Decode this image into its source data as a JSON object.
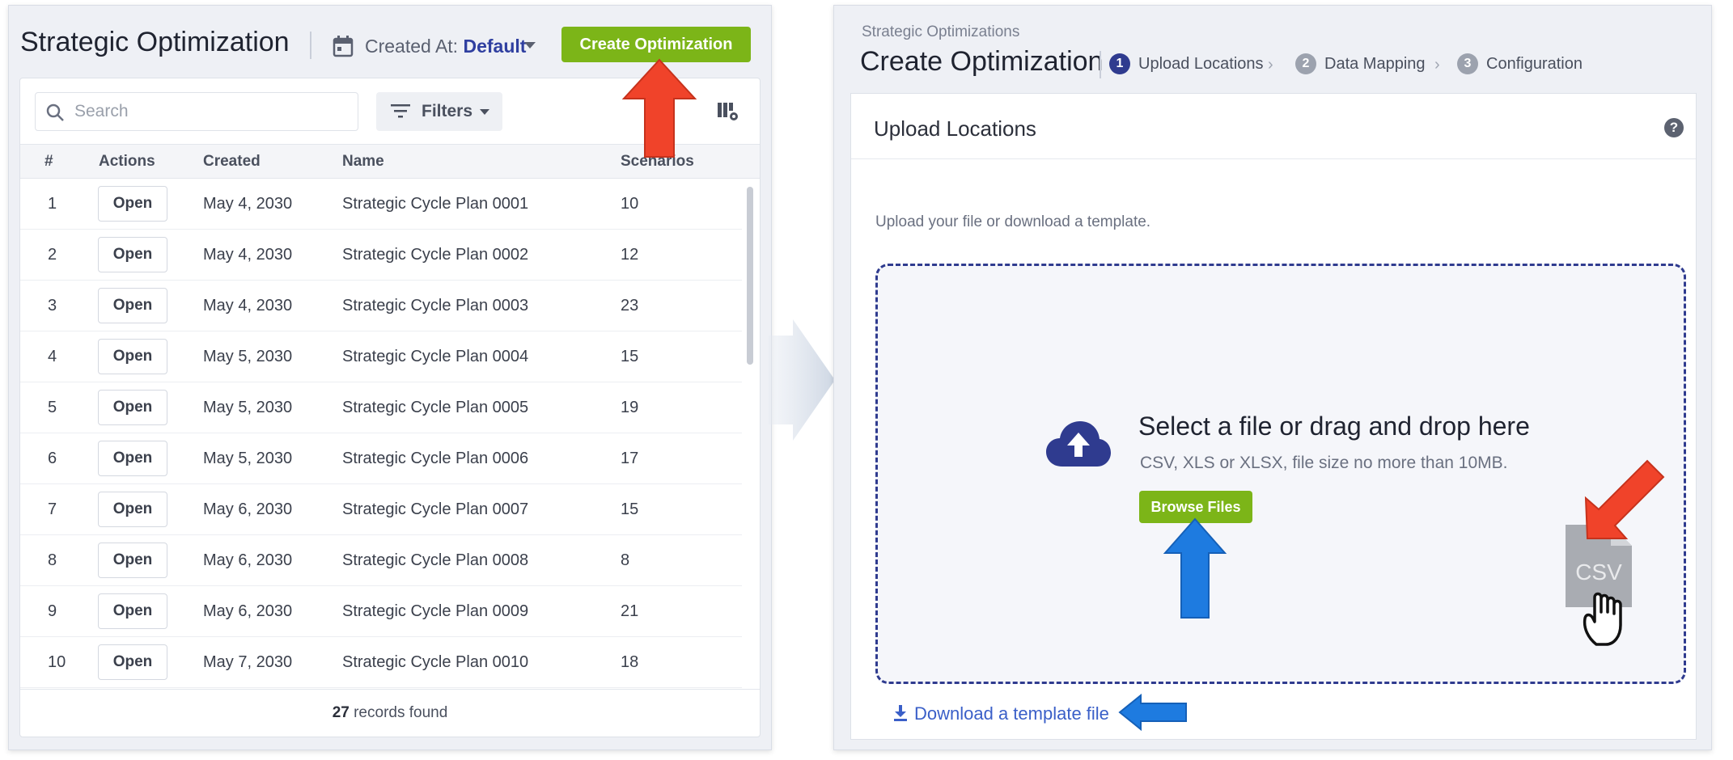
{
  "left": {
    "title": "Strategic Optimization",
    "created_at_label": "Created At:",
    "created_at_value": "Default",
    "create_button": "Create Optimization",
    "search_placeholder": "Search",
    "filters_label": "Filters",
    "columns": {
      "num": "#",
      "actions": "Actions",
      "created": "Created",
      "name": "Name",
      "scenarios": "Scenarios"
    },
    "rows": [
      {
        "num": "1",
        "action": "Open",
        "created": "May 4, 2030",
        "name": "Strategic Cycle Plan 0001",
        "scenarios": "10"
      },
      {
        "num": "2",
        "action": "Open",
        "created": "May 4, 2030",
        "name": "Strategic Cycle Plan 0002",
        "scenarios": "12"
      },
      {
        "num": "3",
        "action": "Open",
        "created": "May 4, 2030",
        "name": "Strategic Cycle Plan 0003",
        "scenarios": "23"
      },
      {
        "num": "4",
        "action": "Open",
        "created": "May 5, 2030",
        "name": "Strategic Cycle Plan 0004",
        "scenarios": "15"
      },
      {
        "num": "5",
        "action": "Open",
        "created": "May 5, 2030",
        "name": "Strategic Cycle Plan 0005",
        "scenarios": "19"
      },
      {
        "num": "6",
        "action": "Open",
        "created": "May 5, 2030",
        "name": "Strategic Cycle Plan 0006",
        "scenarios": "17"
      },
      {
        "num": "7",
        "action": "Open",
        "created": "May 6, 2030",
        "name": "Strategic Cycle Plan 0007",
        "scenarios": "15"
      },
      {
        "num": "8",
        "action": "Open",
        "created": "May 6, 2030",
        "name": "Strategic Cycle Plan 0008",
        "scenarios": "8"
      },
      {
        "num": "9",
        "action": "Open",
        "created": "May 6, 2030",
        "name": "Strategic Cycle Plan 0009",
        "scenarios": "21"
      },
      {
        "num": "10",
        "action": "Open",
        "created": "May 7, 2030",
        "name": "Strategic Cycle Plan 0010",
        "scenarios": "18"
      }
    ],
    "records_count": "27",
    "records_suffix": " records found"
  },
  "right": {
    "breadcrumb": "Strategic Optimizations",
    "title": "Create Optimization",
    "steps": [
      {
        "num": "1",
        "label": "Upload Locations",
        "active": true
      },
      {
        "num": "2",
        "label": "Data Mapping",
        "active": false
      },
      {
        "num": "3",
        "label": "Configuration",
        "active": false
      }
    ],
    "card_title": "Upload Locations",
    "help_glyph": "?",
    "instructions": "Upload your file or download a template.",
    "dropzone_title": "Select a file or drag and drop here",
    "dropzone_sub": "CSV, XLS or XLSX, file size no more than 10MB.",
    "browse_button": "Browse Files",
    "file_label": "CSV",
    "download_link": "Download a template file"
  },
  "colors": {
    "accent_green": "#7cb518",
    "accent_blue": "#2f3b8f",
    "link_blue": "#3a5fc8",
    "arrow_red": "#f0432a",
    "arrow_blue": "#1e7be0"
  },
  "icons": [
    "calendar-icon",
    "caret-down-icon",
    "search-icon",
    "filter-icon",
    "columns-settings-icon",
    "cloud-upload-icon",
    "help-icon",
    "chevron-right-icon",
    "csv-file-icon",
    "hand-cursor-icon",
    "download-icon"
  ]
}
